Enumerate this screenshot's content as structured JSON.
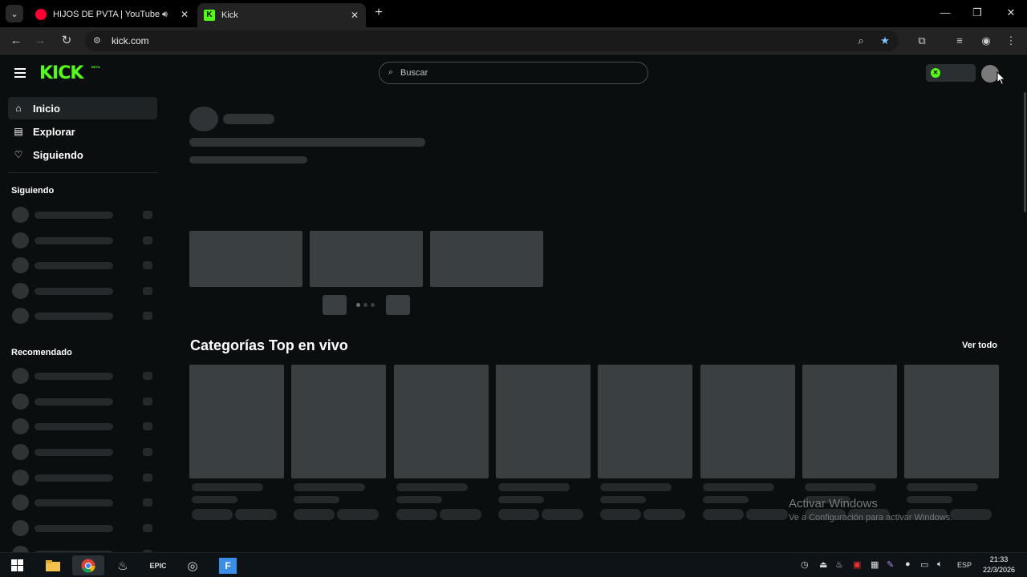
{
  "browser": {
    "tabs": [
      {
        "title": "HIJOS DE PVTA | YouTube M",
        "active": false,
        "favicon": "youtube-music-icon",
        "audio": true
      },
      {
        "title": "Kick",
        "active": true,
        "favicon": "kick-icon"
      }
    ],
    "url": "kick.com",
    "window_controls": {
      "minimize": "—",
      "restore": "❐",
      "close": "✕"
    }
  },
  "header": {
    "logo": "KICK",
    "logo_badge": "BETA",
    "search_placeholder": "Buscar",
    "accent": "#53fc18"
  },
  "sidebar": {
    "nav": [
      {
        "label": "Inicio",
        "icon": "home-icon",
        "active": true
      },
      {
        "label": "Explorar",
        "icon": "explore-icon",
        "active": false
      },
      {
        "label": "Siguiendo",
        "icon": "heart-icon",
        "active": false
      }
    ],
    "following_heading": "Siguiendo",
    "recommended_heading": "Recomendado"
  },
  "main": {
    "section_title": "Categorías Top en vivo",
    "see_all": "Ver todo"
  },
  "watermark": {
    "line1": "Activar Windows",
    "line2": "Ve a Configuración para activar Windows."
  },
  "taskbar": {
    "language": "ESP",
    "time": "21:33",
    "date": "22/3/2026"
  }
}
